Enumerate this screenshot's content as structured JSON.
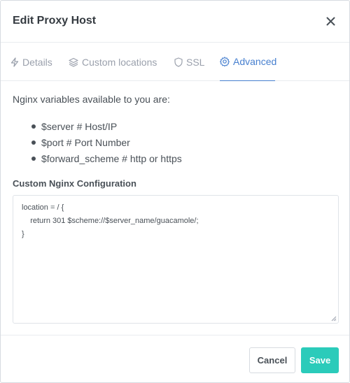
{
  "modal": {
    "title": "Edit Proxy Host",
    "close_icon": "close-icon"
  },
  "tabs": [
    {
      "label": "Details",
      "icon": "bolt-icon",
      "active": false
    },
    {
      "label": "Custom locations",
      "icon": "layers-icon",
      "active": false
    },
    {
      "label": "SSL",
      "icon": "shield-icon",
      "active": false
    },
    {
      "label": "Advanced",
      "icon": "gear-icon",
      "active": true
    }
  ],
  "advanced": {
    "intro": "Nginx variables available to you are:",
    "variables": [
      "$server # Host/IP",
      "$port # Port Number",
      "$forward_scheme # http or https"
    ],
    "config_label": "Custom Nginx Configuration",
    "config_value": "location = / {\n    return 301 $scheme://$server_name/guacamole/;\n}"
  },
  "footer": {
    "cancel_label": "Cancel",
    "save_label": "Save"
  },
  "colors": {
    "accent": "#467fcf",
    "save": "#2bcbba",
    "muted": "#9aa0ac"
  }
}
